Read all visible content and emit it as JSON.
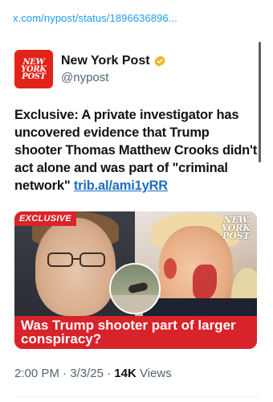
{
  "browser": {
    "url": "x.com/nypost/status/1896636896..."
  },
  "author": {
    "name": "New York Post",
    "handle": "@nypost",
    "verified": true,
    "avatar_text": [
      "NEW",
      "YORK",
      "POST"
    ],
    "avatar_color": "#e2231a",
    "badge_color": "#e8b829"
  },
  "tweet": {
    "text": "Exclusive: A private investigator has uncovered evidence that Trump shooter Thomas Matthew Crooks didn't act alone and was part of \"criminal network\" ",
    "link": "trib.al/ami1yRR",
    "link_color": "#1d6fbf"
  },
  "card": {
    "badge": "EXCLUSIVE",
    "logo_text": [
      "NEW",
      "YORK",
      "POST"
    ],
    "headline": "Was Trump shooter part of larger conspiracy?",
    "accent_color": "#d8232a"
  },
  "meta": {
    "time": "2:00 PM",
    "separator": " · ",
    "date": "3/3/25",
    "views_count": "14K",
    "views_label": " Views"
  }
}
